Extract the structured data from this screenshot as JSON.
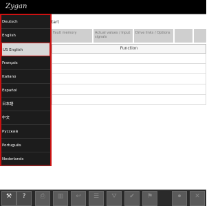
{
  "app": {
    "brand": "Zygan"
  },
  "hint_text": "n start",
  "columns": [
    "Fault memory",
    "Actual values / Input signals",
    "Drive links / Options",
    "",
    ""
  ],
  "grid": {
    "header": "Function",
    "rows": [
      "",
      "",
      "",
      "",
      ""
    ]
  },
  "languages": [
    {
      "label": "Deutsch",
      "selected": false
    },
    {
      "label": "English",
      "selected": false
    },
    {
      "label": "US English",
      "selected": true
    },
    {
      "label": "Français",
      "selected": false
    },
    {
      "label": "Italiano",
      "selected": false
    },
    {
      "label": "Español",
      "selected": false
    },
    {
      "label": "日本語",
      "selected": false
    },
    {
      "label": "中文",
      "selected": false
    },
    {
      "label": "Русский",
      "selected": false
    },
    {
      "label": "Português",
      "selected": false
    },
    {
      "label": "Nederlands",
      "selected": false
    }
  ],
  "toolbar": [
    {
      "name": "tools",
      "glyph": "⚒",
      "caption": "",
      "enabled": true
    },
    {
      "name": "help",
      "glyph": "?",
      "caption": "",
      "enabled": true
    },
    {
      "name": "print",
      "glyph": "⎙",
      "caption": "",
      "enabled": false
    },
    {
      "name": "chart",
      "glyph": "▥",
      "caption": "",
      "enabled": false
    },
    {
      "name": "back",
      "glyph": "↩",
      "caption": "",
      "enabled": false
    },
    {
      "name": "list",
      "glyph": "☰",
      "caption": "",
      "enabled": false
    },
    {
      "name": "filter",
      "glyph": "⛛",
      "caption": "",
      "enabled": false
    },
    {
      "name": "check",
      "glyph": "✔",
      "caption": "",
      "enabled": false
    },
    {
      "name": "flag",
      "glyph": "⚑",
      "caption": "",
      "enabled": false
    },
    {
      "name": "record",
      "glyph": "⏺",
      "caption": "",
      "enabled": false
    },
    {
      "name": "close",
      "glyph": "✕",
      "caption": "",
      "enabled": false
    }
  ]
}
